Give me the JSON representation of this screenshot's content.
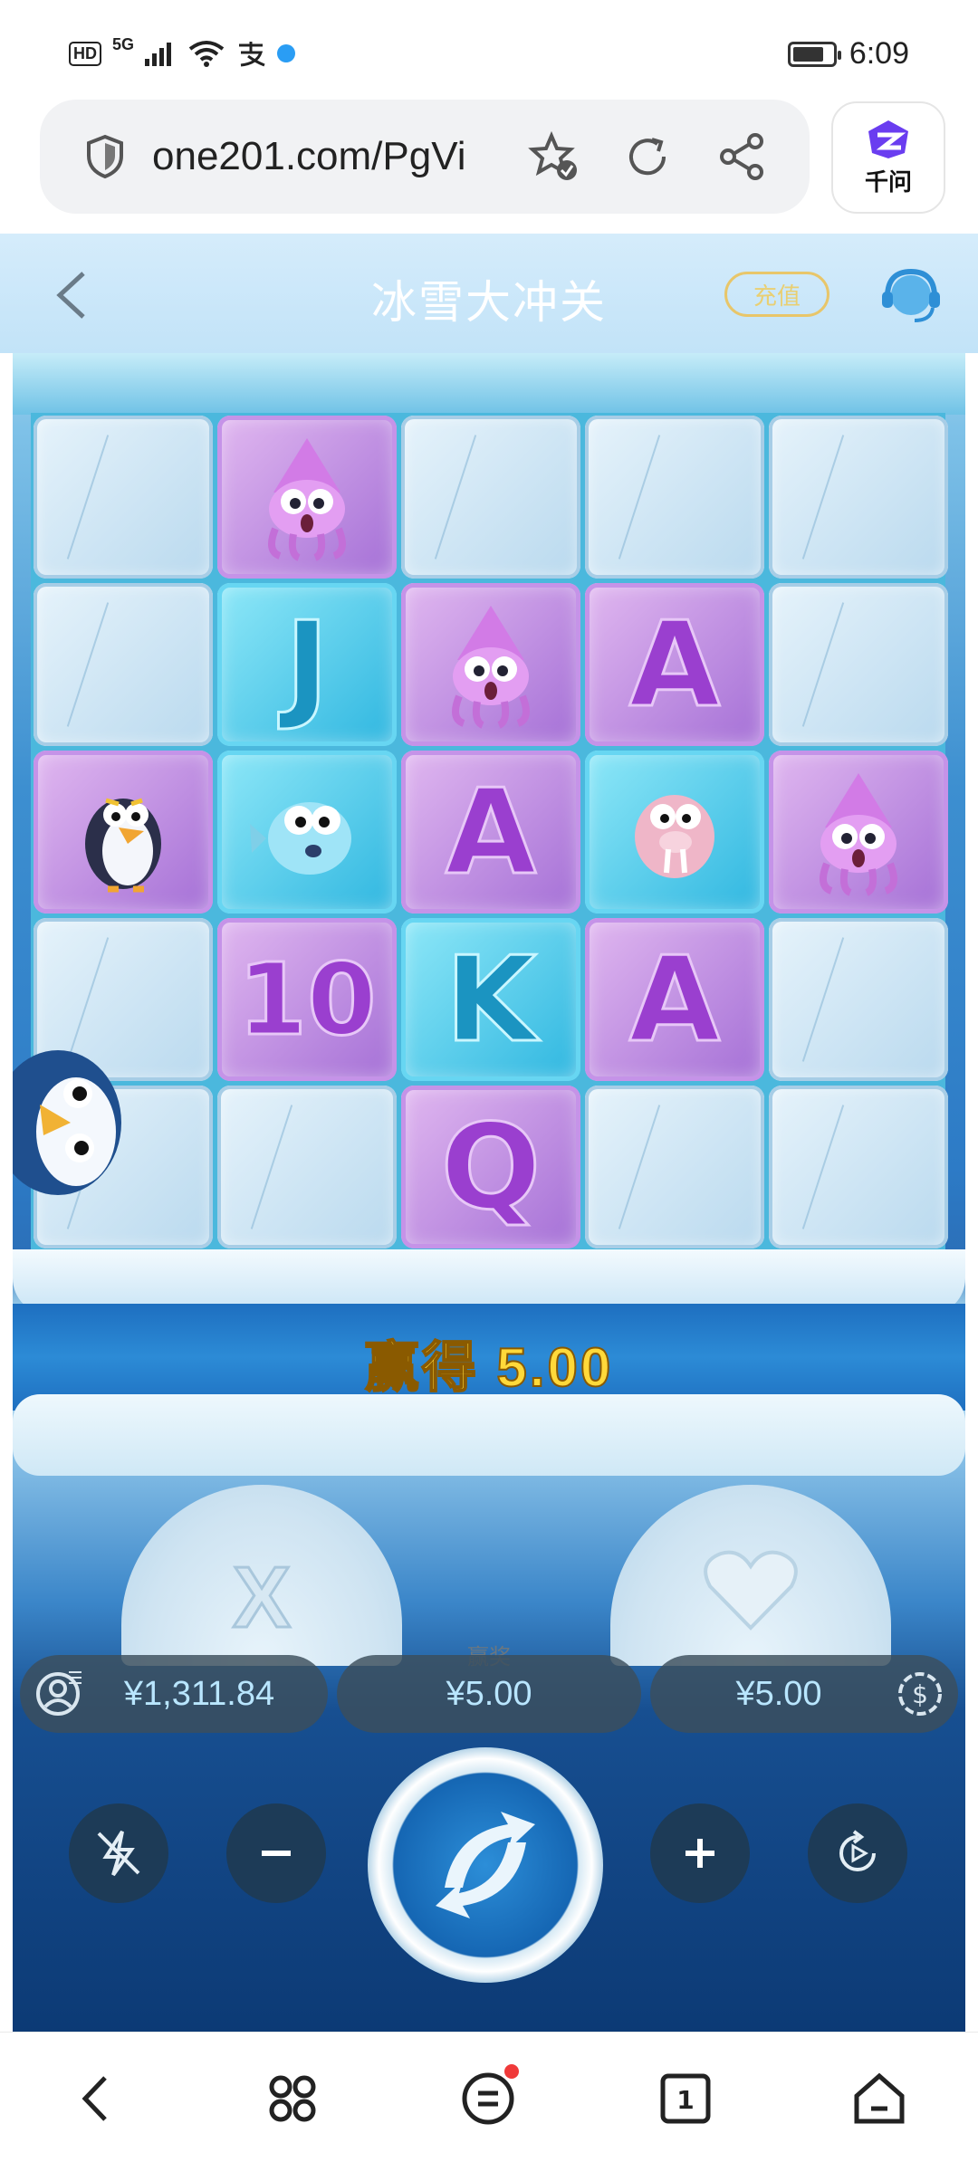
{
  "status_bar": {
    "hd": "HD",
    "network": "5G",
    "time": "6:09",
    "battery_level": 0.8
  },
  "browser": {
    "url": "one201.com/PgVi",
    "qianwen_label": "千问"
  },
  "game_header": {
    "title": "冰雪大冲关",
    "recharge_label": "充值"
  },
  "reels": {
    "rows": [
      [
        "ice",
        "squid",
        "ice",
        "ice",
        "ice"
      ],
      [
        "ice",
        "J",
        "squid",
        "A",
        "ice"
      ],
      [
        "penguin",
        "pufferfish",
        "A",
        "walrus",
        "squid"
      ],
      [
        "ice",
        "10",
        "K",
        "A",
        "ice"
      ],
      [
        "ice",
        "ice",
        "Q",
        "ice",
        "ice"
      ]
    ]
  },
  "win_banner": "赢得 5.00",
  "info": {
    "balance": "¥1,311.84",
    "win_label": "赢奖",
    "win": "¥5.00",
    "bet": "¥5.00"
  },
  "colors": {
    "accent_yellow": "#ffd93a",
    "pill_text": "#b9e6ff",
    "symbol_purple": "#9a3fcf",
    "symbol_cyan": "#1b94c1"
  }
}
